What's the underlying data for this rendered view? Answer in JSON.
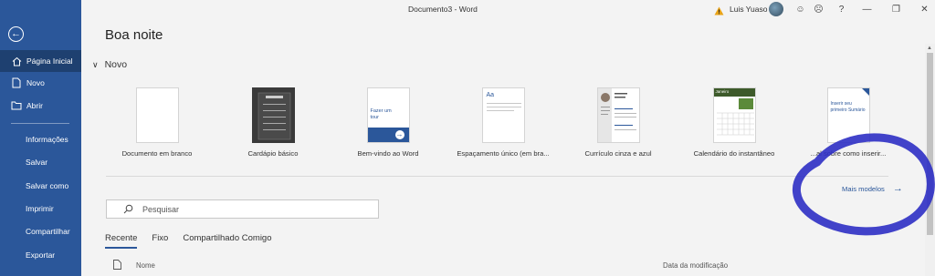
{
  "window": {
    "title": "Documento3  -  Word",
    "user_name": "Luis Yuaso"
  },
  "sidebar": {
    "items": [
      {
        "label": "Página Inicial",
        "icon": "home-icon"
      },
      {
        "label": "Novo",
        "icon": "new-document-icon"
      },
      {
        "label": "Abrir",
        "icon": "folder-icon"
      },
      {
        "label": "Informações"
      },
      {
        "label": "Salvar"
      },
      {
        "label": "Salvar como"
      },
      {
        "label": "Imprimir"
      },
      {
        "label": "Compartilhar"
      },
      {
        "label": "Exportar"
      }
    ]
  },
  "main": {
    "greeting": "Boa noite",
    "new_section": "Novo",
    "templates": [
      {
        "caption": "Documento em branco"
      },
      {
        "caption": "Cardápio básico"
      },
      {
        "caption": "Bem-vindo ao Word",
        "thumb_text": "Fazer um tour"
      },
      {
        "caption": "Espaçamento único (em bra...",
        "thumb_text": "Aa"
      },
      {
        "caption": "Currículo cinza e azul"
      },
      {
        "caption": "Calendário do instantâneo",
        "thumb_text": "Janeiro"
      },
      {
        "caption": "...al sobre como inserir...",
        "thumb_text": "Inserir seu primeiro Sumário"
      }
    ],
    "more_templates": "Mais modelos",
    "search_placeholder": "Pesquisar",
    "tabs": [
      "Recente",
      "Fixo",
      "Compartilhado Comigo"
    ],
    "columns": {
      "name": "Nome",
      "date": "Data da modificação"
    }
  },
  "colors": {
    "brand": "#2b579a",
    "annotation": "#2e2fc4"
  }
}
